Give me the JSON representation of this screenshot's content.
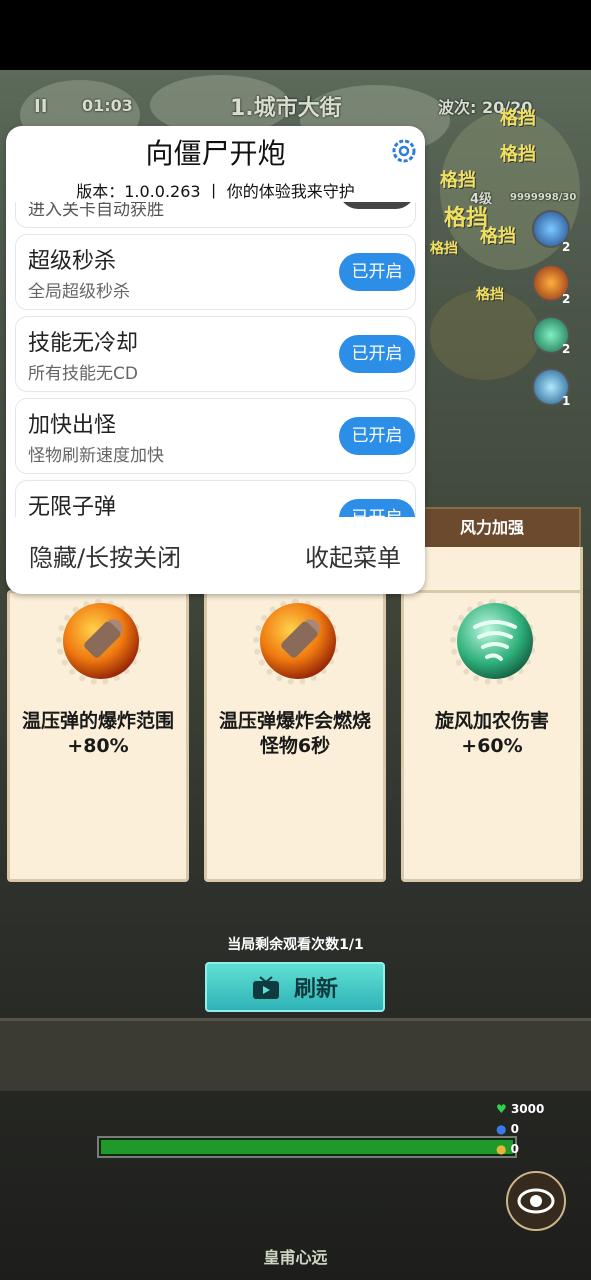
{
  "hud": {
    "time": "01:03",
    "level_name": "1.城市大街",
    "wave": "波次: 20/20",
    "level_tag": "4级",
    "exp": "9999998/30"
  },
  "damage_texts": [
    "格挡",
    "格挡",
    "格挡",
    "格挡",
    "格挡",
    "格挡",
    "格挡"
  ],
  "skills": [
    {
      "icon": "blue-orb-icon",
      "count": "2"
    },
    {
      "icon": "fire-orb-icon",
      "count": "2"
    },
    {
      "icon": "tornado-icon",
      "count": "2"
    },
    {
      "icon": "ice-orb-icon",
      "count": "1"
    }
  ],
  "cards": [
    {
      "banner": "",
      "icon": "thermobaric-shell-icon",
      "text": "温压弹的爆炸范围+80%"
    },
    {
      "banner": "",
      "icon": "thermobaric-shell-icon",
      "text": "温压弹爆炸会燃烧怪物6秒"
    },
    {
      "banner": "风力加强",
      "icon": "tornado-icon",
      "text": "旋风加农伤害+60%"
    }
  ],
  "refresh": {
    "watch_text": "当局剩余观看次数1/1",
    "label": "刷新"
  },
  "base": {
    "player_name": "皇甫心远",
    "resources": [
      "3000",
      "0",
      "0"
    ]
  },
  "menu": {
    "title": "向僵尸开炮",
    "subtitle": "版本：1.0.0.263 丨 你的体验我来守护",
    "cut_item_text": "进入关卡自动获胜",
    "items": [
      {
        "title": "超级秒杀",
        "desc": "全局超级秒杀",
        "button": "已开启"
      },
      {
        "title": "技能无冷却",
        "desc": "所有技能无CD",
        "button": "已开启"
      },
      {
        "title": "加快出怪",
        "desc": "怪物刷新速度加快",
        "button": "已开启"
      },
      {
        "title": "无限子弹",
        "desc": "",
        "button": "已开启"
      }
    ],
    "hide_label": "隐藏/长按关闭",
    "collapse_label": "收起菜单"
  }
}
